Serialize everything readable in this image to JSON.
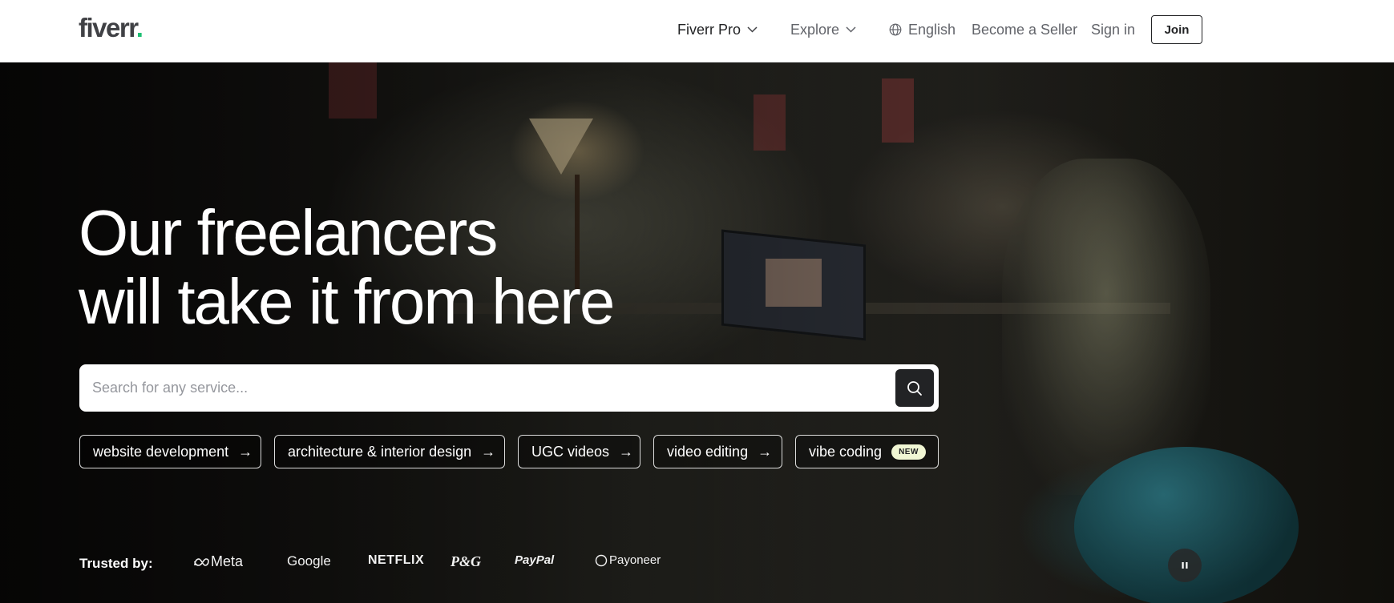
{
  "header": {
    "logo": {
      "text": "fiverr",
      "dot": "."
    },
    "nav": {
      "fiverr_pro": "Fiverr Pro",
      "explore": "Explore",
      "language": "English",
      "become_seller": "Become a Seller",
      "sign_in": "Sign in",
      "join": "Join"
    }
  },
  "hero": {
    "headline_line1": "Our freelancers",
    "headline_line2": "will take it from here",
    "search": {
      "placeholder": "Search for any service..."
    },
    "chips": [
      {
        "label": "website development"
      },
      {
        "label": "architecture & interior design"
      },
      {
        "label": "UGC videos"
      },
      {
        "label": "video editing"
      },
      {
        "label": "vibe coding",
        "badge": "NEW"
      }
    ],
    "trusted_by": {
      "label": "Trusted by:",
      "brands": [
        "Meta",
        "Google",
        "NETFLIX",
        "P&G",
        "PayPal",
        "Payoneer"
      ]
    }
  },
  "colors": {
    "brand_green": "#1dbf73",
    "text_dark": "#222325",
    "new_badge": "#f1f7d4"
  },
  "icons": [
    "chevron-down-icon",
    "globe-icon",
    "search-icon",
    "arrow-right-icon",
    "meta-logo-icon",
    "payoneer-ring-icon",
    "pause-icon"
  ]
}
